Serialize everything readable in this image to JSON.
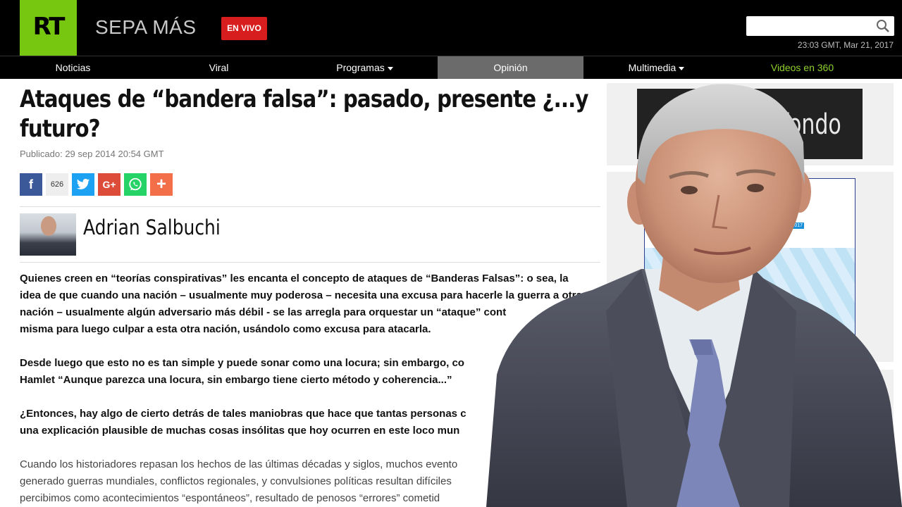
{
  "header": {
    "logo_text": "RT",
    "site_name": "SEPA MÁS",
    "live_label": "EN VIVO",
    "datetime": "23:03 GMT, Mar 21, 2017",
    "search_placeholder": ""
  },
  "nav": [
    {
      "label": "Noticias"
    },
    {
      "label": "Viral"
    },
    {
      "label": "Programas"
    },
    {
      "label": "Opinión"
    },
    {
      "label": "Multimedia"
    },
    {
      "label": "Videos en 360"
    }
  ],
  "article": {
    "headline": "Ataques de “bandera falsa”: pasado, presente ¿...y futuro?",
    "published": "Publicado: 29 sep 2014 20:54 GMT",
    "share_count": "626",
    "author": "Adrian Salbuchi",
    "paragraphs": [
      "Quienes creen en “teorías conspirativas” les encanta el concepto de ataques de “Banderas Falsas”: o sea, la idea de que cuando una nación – usualmente muy poderosa – necesita una excusa para hacerle la guerra a otra nación – usualmente algún adversario más débil - se las arregla para orquestar un “ataque” cont",
      "misma para luego culpar a esta otra nación, usándolo como excusa para atacarla.",
      "Desde luego que esto no es tan simple y puede sonar como una locura; sin embargo, co",
      "Hamlet “Aunque parezca una locura, sin embargo tiene cierto método y coherencia...”",
      "¿Entonces, hay algo de cierto detrás de tales maniobras que hace que tantas personas c",
      "una explicación plausible de muchas cosas insólitas que hoy ocurren en este loco mun",
      "Cuando los historiadores repasan los hechos de las últimas décadas y siglos, muchos evento",
      "generado guerras mundiales, conflictos regionales, y convulsiones políticas resultan difíciles",
      "percibimos como acontecimientos “espontáneos”, resultado de penosos “errores” cometid"
    ]
  },
  "sidebar": {
    "ad_top_text": "fondo"
  },
  "colors": {
    "brand_green": "#77c60f",
    "live_red": "#d71d1d",
    "nav_active": "#6b6b6b",
    "videos360_green": "#8ed12c"
  }
}
